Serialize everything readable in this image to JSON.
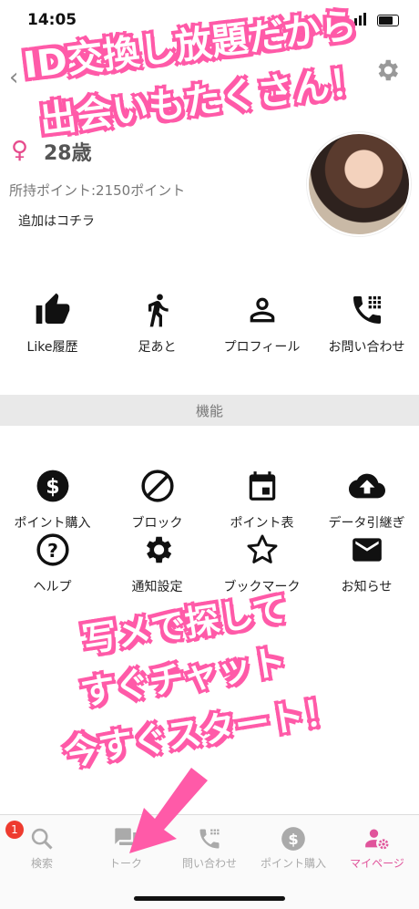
{
  "status": {
    "time": "14:05"
  },
  "profile": {
    "gender_symbol": "♀",
    "age": "28歳",
    "points": "所持ポイント:2150ポイント",
    "add_link": "追加はコチラ"
  },
  "quick_actions": [
    {
      "label": "Like履歴",
      "icon": "thumbs-up-icon"
    },
    {
      "label": "足あと",
      "icon": "walking-person-icon"
    },
    {
      "label": "プロフィール",
      "icon": "person-icon"
    },
    {
      "label": "お問い合わせ",
      "icon": "phone-dialpad-icon"
    }
  ],
  "section": {
    "title": "機能"
  },
  "features_row1": [
    {
      "label": "ポイント購入",
      "icon": "dollar-coin-icon"
    },
    {
      "label": "ブロック",
      "icon": "block-icon"
    },
    {
      "label": "ポイント表",
      "icon": "calendar-icon"
    },
    {
      "label": "データ引継ぎ",
      "icon": "cloud-upload-icon"
    }
  ],
  "features_row2": [
    {
      "label": "ヘルプ",
      "icon": "help-icon"
    },
    {
      "label": "通知設定",
      "icon": "gear-icon"
    },
    {
      "label": "ブックマーク",
      "icon": "star-icon"
    },
    {
      "label": "お知らせ",
      "icon": "mail-icon"
    }
  ],
  "promo": {
    "top_line1": "ID交換し放題だから",
    "top_line2": "出会いもたくさん！",
    "bottom_line1": "写メで探して",
    "bottom_line2": "すぐチャット",
    "bottom_line3": "今すぐスタート！"
  },
  "tabs": [
    {
      "label": "検索",
      "icon": "search-icon",
      "active": false
    },
    {
      "label": "トーク",
      "icon": "chat-icon",
      "active": false
    },
    {
      "label": "問い合わせ",
      "icon": "phone-dialpad-icon",
      "active": false
    },
    {
      "label": "ポイント購入",
      "icon": "dollar-coin-icon",
      "active": false
    },
    {
      "label": "マイページ",
      "icon": "user-settings-icon",
      "active": true
    }
  ],
  "badge": {
    "count": "1"
  },
  "colors": {
    "accent": "#e0549b",
    "promo": "#ff5aa8",
    "badge": "#ee3b2f"
  }
}
